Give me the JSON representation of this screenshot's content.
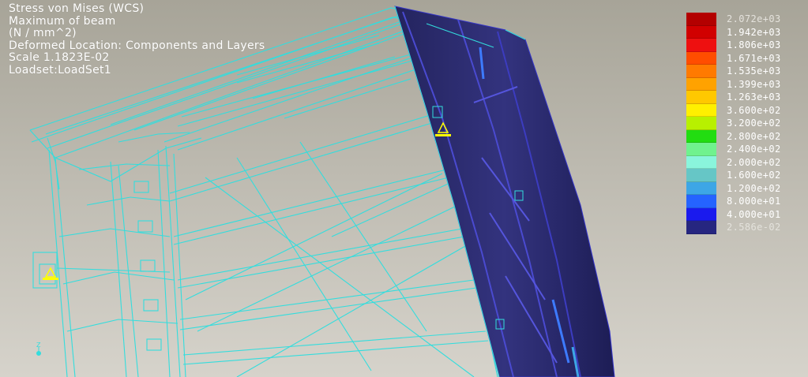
{
  "info": {
    "title": "Stress von Mises (WCS)",
    "subtitle": "Maximum of beam",
    "units": "(N / mm^2)",
    "location": "Deformed Location: Components and Layers",
    "scale": "Scale    1.1823E-02",
    "loadset": "Loadset:LoadSet1"
  },
  "legend": {
    "entries": [
      {
        "value": "2.072e+03",
        "color": "#b30000",
        "dim": true
      },
      {
        "value": "1.942e+03",
        "color": "#d10000"
      },
      {
        "value": "1.806e+03",
        "color": "#ee1010"
      },
      {
        "value": "1.671e+03",
        "color": "#ff4d00"
      },
      {
        "value": "1.535e+03",
        "color": "#ff7a00"
      },
      {
        "value": "1.399e+03",
        "color": "#ffa200"
      },
      {
        "value": "1.263e+03",
        "color": "#ffc800"
      },
      {
        "value": "3.600e+02",
        "color": "#fff000"
      },
      {
        "value": "3.200e+02",
        "color": "#b8f000"
      },
      {
        "value": "2.800e+02",
        "color": "#22dd11"
      },
      {
        "value": "2.400e+02",
        "color": "#70f28e"
      },
      {
        "value": "2.000e+02",
        "color": "#8af5dc"
      },
      {
        "value": "1.600e+02",
        "color": "#66c6c6"
      },
      {
        "value": "1.200e+02",
        "color": "#3da6e6"
      },
      {
        "value": "8.000e+01",
        "color": "#2563ff"
      },
      {
        "value": "4.000e+01",
        "color": "#1a1aee"
      },
      {
        "value": "2.586e-02",
        "color": "#262680",
        "dim": true
      }
    ]
  },
  "colors": {
    "wireframe": "#33dddd",
    "beam": "#2b2b72",
    "constraint": "#ffff00",
    "labelText": "#ffffff"
  },
  "axis": {
    "z_label": "Z"
  }
}
